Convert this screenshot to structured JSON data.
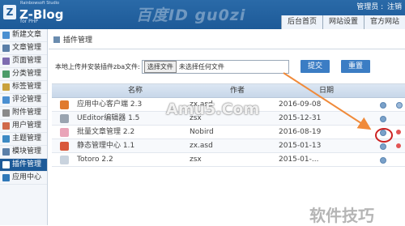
{
  "header": {
    "logo_mark": "Z",
    "logo_name": "Z-Blog",
    "logo_studio": "Rainbowsoft Studio",
    "logo_sub": "for PHP",
    "watermark": "百度ID gu0zi",
    "user_label": "管理员 :",
    "logout": "注销",
    "tabs": [
      "后台首页",
      "网站设置",
      "官方网站"
    ]
  },
  "sidebar": {
    "items": [
      {
        "label": "新建文章",
        "icon_color": "#4a8fd1"
      },
      {
        "label": "文章管理",
        "icon_color": "#5b7fa8"
      },
      {
        "label": "页面管理",
        "icon_color": "#7d6bb0"
      },
      {
        "label": "分类管理",
        "icon_color": "#4c9c6a"
      },
      {
        "label": "标签管理",
        "icon_color": "#c9a23c"
      },
      {
        "label": "评论管理",
        "icon_color": "#4a8fd1"
      },
      {
        "label": "附件管理",
        "icon_color": "#8a8a8a"
      },
      {
        "label": "用户管理",
        "icon_color": "#d06a4a"
      },
      {
        "label": "主题管理",
        "icon_color": "#3d8ac4"
      },
      {
        "label": "模块管理",
        "icon_color": "#5b7fa8"
      },
      {
        "label": "插件管理",
        "icon_color": "#ffffff"
      },
      {
        "label": "应用中心",
        "icon_color": "#2f78b8"
      }
    ],
    "active_index": 10
  },
  "main": {
    "title": "插件管理",
    "upload_label": "本地上传并安装插件zba文件:",
    "choose_file": "选择文件",
    "no_file": "未选择任何文件",
    "submit": "提交",
    "reset": "重置"
  },
  "table": {
    "headers": {
      "name": "名称",
      "author": "作者",
      "date": "日期"
    },
    "rows": [
      {
        "name": "应用中心客户端 2.3",
        "author": "zx.asd",
        "date": "2016-09-08",
        "icon_color": "#e07a2e",
        "enabled": true,
        "extra": "blue"
      },
      {
        "name": "UEditor编辑器 1.5",
        "author": "zsx",
        "date": "2015-12-31",
        "icon_color": "#9aa4b0",
        "enabled": true,
        "extra": "none"
      },
      {
        "name": "批量文章管理 2.2",
        "author": "Nobird",
        "date": "2016-08-19",
        "icon_color": "#e9a4b8",
        "enabled": false,
        "extra": "red"
      },
      {
        "name": "静态管理中心 1.1",
        "author": "zx.asd",
        "date": "2015-01-13",
        "icon_color": "#d9583a",
        "enabled": false,
        "extra": "red"
      },
      {
        "name": "Totoro 2.2",
        "author": "zsx",
        "date": "2015-01-...",
        "icon_color": "#c9d3de",
        "enabled": true,
        "extra": "none"
      }
    ]
  },
  "watermarks": {
    "center": "Amu5.Com",
    "bottom": "软件技巧"
  },
  "colors": {
    "header_bg": "#1d5a98",
    "accent": "#3b7dc4",
    "arrow": "#f08a3a",
    "highlight": "#cc2222"
  }
}
